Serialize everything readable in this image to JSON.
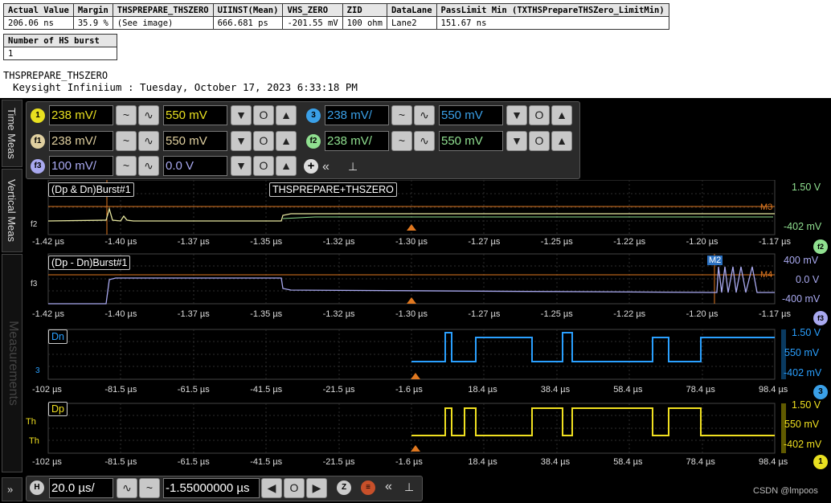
{
  "results_table": {
    "headers": [
      "Actual Value",
      "Margin",
      "THSPREPARE_THSZERO",
      "UIINST(Mean)",
      "VHS_ZERO",
      "ZID",
      "DataLane",
      "PassLimit Min (TXTHSPrepareTHSZero_LimitMin)"
    ],
    "row": [
      "206.06 ns",
      "35.9 %",
      "(See image)",
      "666.681 ps",
      "-201.55 mV",
      "100 ohm",
      "Lane2",
      "151.67 ns"
    ]
  },
  "burst_table": {
    "header": "Number of HS burst",
    "value": "1"
  },
  "screenshot_title": "THSPREPARE_THSZERO",
  "instrument_line": "Keysight Infiniium : Tuesday, October 17, 2023 6:33:18 PM",
  "side_tabs": {
    "time_meas": "Time Meas",
    "vertical_meas": "Vertical Meas",
    "measurements": "Measurements"
  },
  "channels": [
    {
      "badge": "1",
      "scale": "238 mV/",
      "offset": "550 mV",
      "color": "#e8e020"
    },
    {
      "badge": "3",
      "scale": "238 mV/",
      "offset": "550 mV",
      "color": "#3aa0e8"
    },
    {
      "badge": "f1",
      "scale": "238 mV/",
      "offset": "550 mV",
      "color": "#e0d0a0"
    },
    {
      "badge": "f2",
      "scale": "238 mV/",
      "offset": "550 mV",
      "color": "#90e090"
    },
    {
      "badge": "f3",
      "scale": "100 mV/",
      "offset": "0.0 V",
      "color": "#a9a9f0"
    }
  ],
  "panels": [
    {
      "title": "(Dp & Dn)Burst#1",
      "annotation": "THSPREPARE+THSZERO",
      "marker_label": "f2",
      "right_top": "1.50 V",
      "right_mid": "M3",
      "right_bot": "-402 mV",
      "badge": "f2",
      "ticks": [
        "-1.42 µs",
        "-1.40 µs",
        "-1.37 µs",
        "-1.35 µs",
        "-1.32 µs",
        "-1.30 µs",
        "-1.27 µs",
        "-1.25 µs",
        "-1.22 µs",
        "-1.20 µs",
        "-1.17 µs"
      ]
    },
    {
      "title": "(Dp - Dn)Burst#1",
      "marker_label": "f3",
      "cursor_label": "M2",
      "right_top": "400 mV",
      "right_mid": "0.0 V",
      "right_mid2": "M4",
      "right_bot": "-400 mV",
      "badge": "f3",
      "ticks": [
        "-1.42 µs",
        "-1.40 µs",
        "-1.37 µs",
        "-1.35 µs",
        "-1.32 µs",
        "-1.30 µs",
        "-1.27 µs",
        "-1.25 µs",
        "-1.22 µs",
        "-1.20 µs",
        "-1.17 µs"
      ]
    },
    {
      "title": "Dn",
      "marker_label": "3",
      "right_top": "1.50 V",
      "right_mid": "550 mV",
      "right_bot": "-402 mV",
      "badge": "3",
      "ticks": [
        "-102 µs",
        "-81.5 µs",
        "-61.5 µs",
        "-41.5 µs",
        "-21.5 µs",
        "-1.6 µs",
        "18.4 µs",
        "38.4 µs",
        "58.4 µs",
        "78.4 µs",
        "98.4 µs"
      ]
    },
    {
      "title": "Dp",
      "marker_label": "Th",
      "marker_label2": "Th",
      "right_top": "1.50 V",
      "right_mid": "550 mV",
      "right_bot": "-402 mV",
      "badge": "1",
      "ticks": [
        "-102 µs",
        "-81.5 µs",
        "-61.5 µs",
        "-41.5 µs",
        "-21.5 µs",
        "-1.6 µs",
        "18.4 µs",
        "38.4 µs",
        "58.4 µs",
        "78.4 µs",
        "98.4 µs"
      ]
    }
  ],
  "timebase": {
    "badge": "H",
    "scale": "20.0 µs/",
    "position": "-1.55000000 µs"
  },
  "watermark": "CSDN @lmpoos"
}
